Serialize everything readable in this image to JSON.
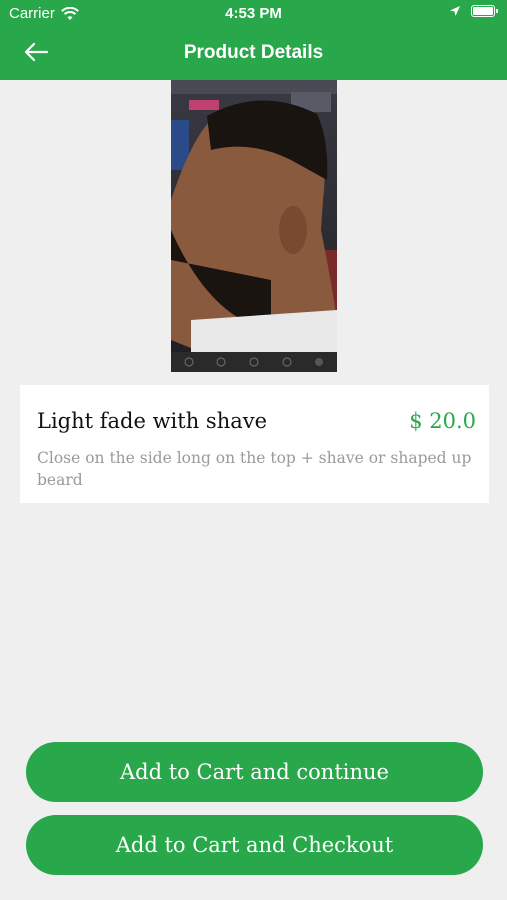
{
  "status_bar": {
    "carrier": "Carrier",
    "time": "4:53 PM"
  },
  "header": {
    "title": "Product Details"
  },
  "product": {
    "name": "Light fade with shave",
    "price": "$ 20.0",
    "description": "Close on the side long on the top + shave or shaped up beard"
  },
  "buttons": {
    "add_continue": "Add to Cart and continue",
    "add_checkout": "Add to Cart and Checkout"
  },
  "colors": {
    "accent": "#28a84a",
    "background": "#efefef"
  }
}
